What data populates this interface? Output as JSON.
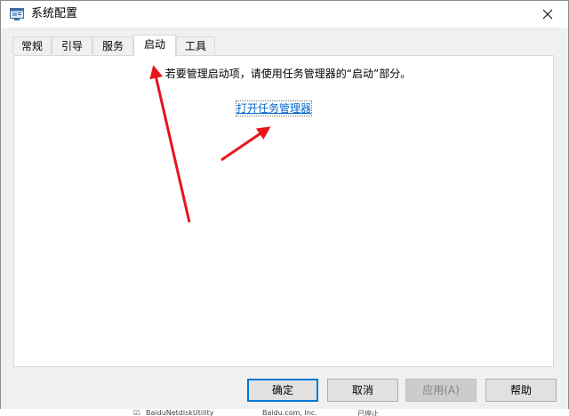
{
  "window": {
    "title": "系统配置",
    "close_glyph": "✕"
  },
  "tabs": [
    {
      "label": "常规"
    },
    {
      "label": "引导"
    },
    {
      "label": "服务"
    },
    {
      "label": "启动",
      "active": true
    },
    {
      "label": "工具"
    }
  ],
  "startup": {
    "message": "若要管理启动项，请使用任务管理器的“启动”部分。",
    "link_label": "打开任务管理器"
  },
  "buttons": {
    "ok_label": "确定",
    "cancel_label": "取消",
    "apply_label": "应用(A)",
    "help_label": "帮助"
  },
  "background_row": {
    "name": "BaiduNetdiskUtility",
    "company": "Baidu.com, Inc.",
    "status": "已停止"
  },
  "colors": {
    "annotation_arrow": "#e8141e",
    "link": "#0066cc",
    "default_button_border": "#0078d7"
  },
  "icons": {
    "app": "msconfig-icon",
    "close": "close-icon"
  }
}
